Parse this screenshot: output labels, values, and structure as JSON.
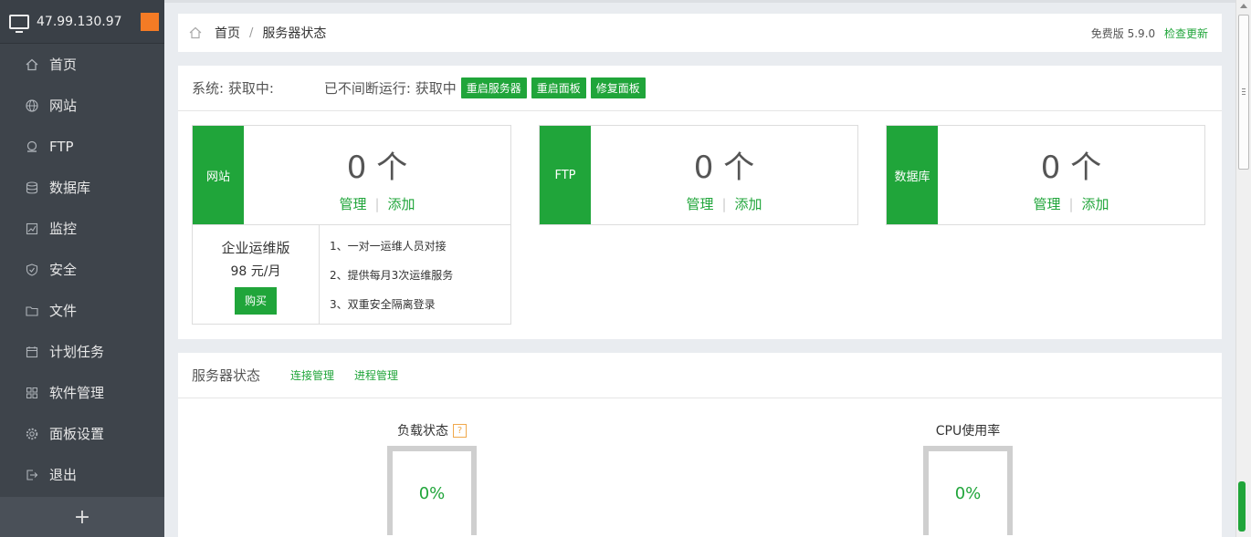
{
  "sidebar": {
    "ip": "47.99.130.97",
    "items": [
      {
        "label": "首页",
        "icon": "home-icon"
      },
      {
        "label": "网站",
        "icon": "globe-icon"
      },
      {
        "label": "FTP",
        "icon": "ftp-icon"
      },
      {
        "label": "数据库",
        "icon": "database-icon"
      },
      {
        "label": "监控",
        "icon": "monitor-icon"
      },
      {
        "label": "安全",
        "icon": "shield-icon"
      },
      {
        "label": "文件",
        "icon": "folder-icon"
      },
      {
        "label": "计划任务",
        "icon": "calendar-icon"
      },
      {
        "label": "软件管理",
        "icon": "grid-icon"
      },
      {
        "label": "面板设置",
        "icon": "gear-icon"
      },
      {
        "label": "退出",
        "icon": "logout-icon"
      }
    ],
    "add": "+"
  },
  "breadcrumb": {
    "home": "首页",
    "sep": "/",
    "current": "服务器状态",
    "version": "免费版 5.9.0",
    "update": "检查更新"
  },
  "system": {
    "os": "系统: 获取中:",
    "uptime": "已不间断运行: 获取中",
    "buttons": [
      "重启服务器",
      "重启面板",
      "修复面板"
    ]
  },
  "stats": [
    {
      "label": "网站",
      "count": "0 个",
      "manage": "管理",
      "add": "添加"
    },
    {
      "label": "FTP",
      "count": "0 个",
      "manage": "管理",
      "add": "添加"
    },
    {
      "label": "数据库",
      "count": "0 个",
      "manage": "管理",
      "add": "添加"
    }
  ],
  "enterprise": {
    "title": "企业运维版",
    "price": "98 元/月",
    "buy": "购买",
    "features": [
      "1、一对一运维人员对接",
      "2、提供每月3次运维服务",
      "3、双重安全隔离登录"
    ]
  },
  "server_status": {
    "title": "服务器状态",
    "links": [
      "连接管理",
      "进程管理"
    ],
    "gauges": [
      {
        "title": "负载状态",
        "help": "?",
        "value": "0%"
      },
      {
        "title": "CPU使用率",
        "value": "0%"
      }
    ]
  },
  "colors": {
    "accent": "#20a53a",
    "sidebar": "#3e444b",
    "orange": "#f47b25"
  }
}
